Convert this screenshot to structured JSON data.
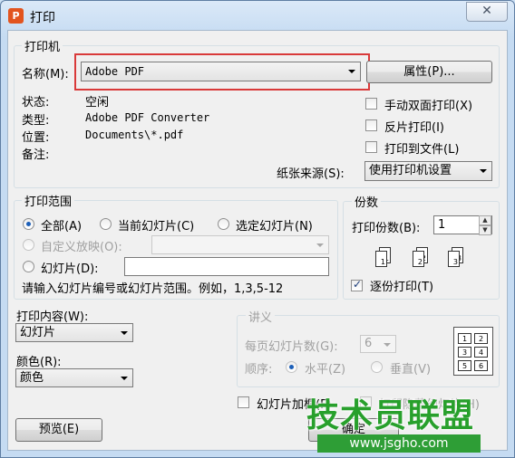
{
  "window": {
    "title": "打印",
    "logo": "P",
    "close": "✕"
  },
  "printer": {
    "group_label": "打印机",
    "name_label": "名称(M):",
    "name_value": "Adobe PDF",
    "properties_button": "属性(P)...",
    "status_label": "状态:",
    "status_value": "空闲",
    "type_label": "类型:",
    "type_value": "Adobe PDF Converter",
    "where_label": "位置:",
    "where_value": "Documents\\*.pdf",
    "comment_label": "备注:",
    "manual_duplex": "手动双面打印(X)",
    "reverse_print": "反片打印(I)",
    "print_to_file": "打印到文件(L)",
    "paper_source_label": "纸张来源(S):",
    "paper_source_value": "使用打印机设置"
  },
  "range": {
    "group_label": "打印范围",
    "all": "全部(A)",
    "current_slide": "当前幻灯片(C)",
    "selected_slides": "选定幻灯片(N)",
    "custom_show": "自定义放映(O):",
    "slides": "幻灯片(D):",
    "hint": "请输入幻灯片编号或幻灯片范围。例如，1,3,5-12"
  },
  "copies": {
    "group_label": "份数",
    "count_label": "打印份数(B):",
    "count_value": "1",
    "collate_label": "逐份打印(T)",
    "collate_pages": [
      "1",
      "2",
      "3"
    ]
  },
  "content": {
    "print_what_label": "打印内容(W):",
    "print_what_value": "幻灯片",
    "color_label": "颜色(R):",
    "color_value": "颜色"
  },
  "handouts": {
    "group_label": "讲义",
    "per_page_label": "每页幻灯片数(G):",
    "per_page_value": "6",
    "order_label": "顺序:",
    "horizontal": "水平(Z)",
    "vertical": "垂直(V)",
    "grid_numbers": [
      "1",
      "2",
      "3",
      "4",
      "5",
      "6"
    ]
  },
  "options": {
    "frame_slides": "幻灯片加框(F)",
    "print_hidden": "打印隐藏幻灯片(H)"
  },
  "footer": {
    "preview_button": "预览(E)",
    "ok_button": "确定"
  },
  "watermark": {
    "brand": "技术员联盟",
    "url": "www.jsgho.com"
  },
  "colors": {
    "accent": "#1c5fb8",
    "highlight_box": "#d93a3a",
    "watermark": "#28a02c"
  }
}
